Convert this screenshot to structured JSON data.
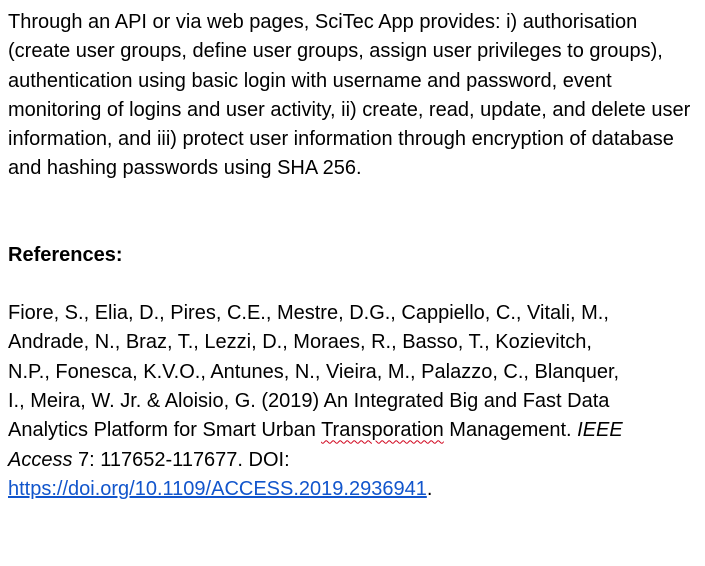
{
  "intro": {
    "text": "Through an API or via web pages, SciTec App provides: i) authorisation (create user groups, define user groups, assign user privileges to groups), authentication using basic login with username and password, event monitoring of logins and user activity, ii) create, read, update, and delete user information, and iii) protect user information through encryption of database and hashing passwords using SHA 256."
  },
  "references": {
    "heading": "References:",
    "entry": {
      "line1": "Fiore, S., Elia, D., Pires, C.E., Mestre, D.G., Cappiello, C., Vitali, M.,",
      "line2": "Andrade, N., Braz, T., Lezzi, D., Moraes, R., Basso, T., Kozievitch,",
      "line3": "N.P., Fonesca, K.V.O., Antunes, N., Vieira, M., Palazzo, C., Blanquer,",
      "line4": "I., Meira, W. Jr. & Aloisio, G. (2019) An Integrated Big and Fast Data",
      "line5_pre": "Analytics Platform for Smart Urban ",
      "line5_flagged": "Transporation",
      "line5_post": " Management. ",
      "journal_part1": "IEEE",
      "journal_part2": "Access",
      "volume_pages": " 7: 117652-117677. DOI:",
      "doi_link": "https://doi.org/10.1109/ACCESS.2019.2936941",
      "trailing_period": "."
    }
  },
  "colors": {
    "link": "#1155cc",
    "spellcheck_underline": "#d0021b"
  }
}
